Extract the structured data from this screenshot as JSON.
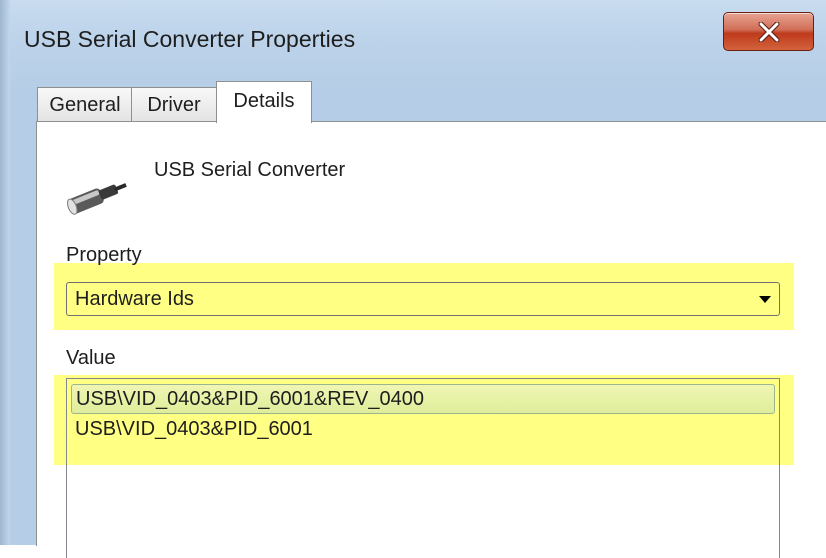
{
  "window": {
    "title": "USB Serial Converter Properties",
    "close_icon": "close-icon"
  },
  "tabs": [
    {
      "label": "General",
      "active": false
    },
    {
      "label": "Driver",
      "active": false
    },
    {
      "label": "Details",
      "active": true
    }
  ],
  "device": {
    "icon": "usb-plug-icon",
    "name": "USB Serial Converter"
  },
  "property": {
    "label": "Property",
    "selected": "Hardware Ids"
  },
  "value": {
    "label": "Value",
    "items": [
      {
        "text": "USB\\VID_0403&PID_6001&REV_0400",
        "selected": true
      },
      {
        "text": "USB\\VID_0403&PID_6001",
        "selected": false
      }
    ]
  },
  "colors": {
    "highlight": "#ffff6e",
    "titlebar": "#bcd3ea",
    "close_button": "#c7452a"
  }
}
